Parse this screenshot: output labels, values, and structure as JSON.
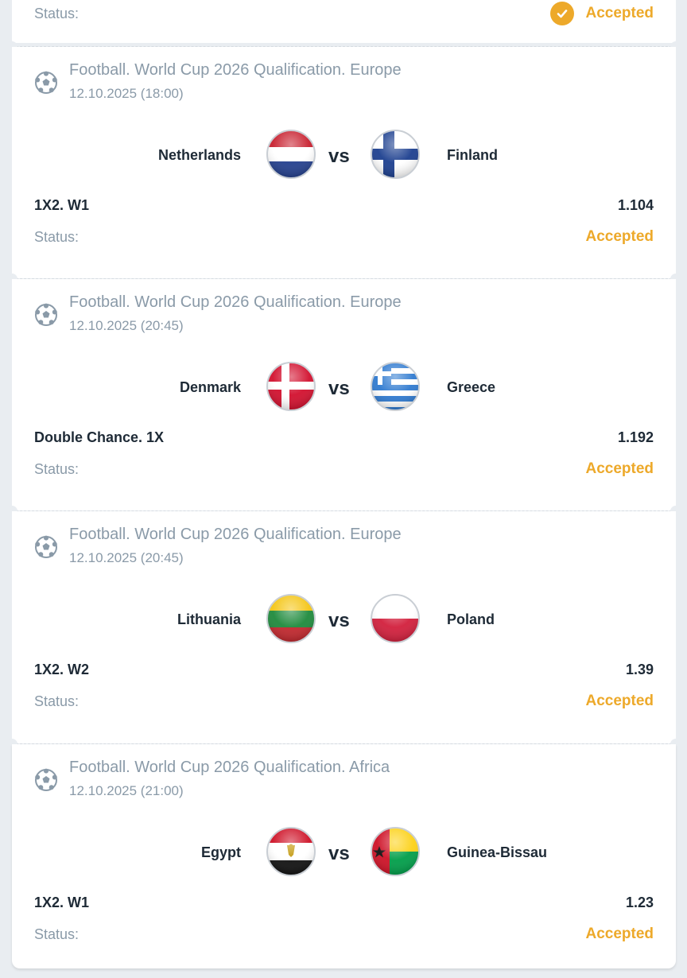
{
  "status_label": "Status:",
  "vs_label": "vs",
  "accent_color": "#eda92a",
  "top_status": {
    "label": "Status:",
    "value": "Accepted"
  },
  "bets": [
    {
      "league": "Football. World Cup 2026 Qualification. Europe",
      "date": "12.10.2025 (18:00)",
      "home": "Netherlands",
      "away": "Finland",
      "market": "1X2. W1",
      "odds": "1.104",
      "status": "Accepted",
      "home_flag": "netherlands-flag",
      "away_flag": "finland-flag"
    },
    {
      "league": "Football. World Cup 2026 Qualification. Europe",
      "date": "12.10.2025 (20:45)",
      "home": "Denmark",
      "away": "Greece",
      "market": "Double Chance. 1X",
      "odds": "1.192",
      "status": "Accepted",
      "home_flag": "denmark-flag",
      "away_flag": "greece-flag"
    },
    {
      "league": "Football. World Cup 2026 Qualification. Europe",
      "date": "12.10.2025 (20:45)",
      "home": "Lithuania",
      "away": "Poland",
      "market": "1X2. W2",
      "odds": "1.39",
      "status": "Accepted",
      "home_flag": "lithuania-flag",
      "away_flag": "poland-flag"
    },
    {
      "league": "Football. World Cup 2026 Qualification. Africa",
      "date": "12.10.2025 (21:00)",
      "home": "Egypt",
      "away": "Guinea-Bissau",
      "market": "1X2. W1",
      "odds": "1.23",
      "status": "Accepted",
      "home_flag": "egypt-flag",
      "away_flag": "guinea-bissau-flag"
    }
  ]
}
